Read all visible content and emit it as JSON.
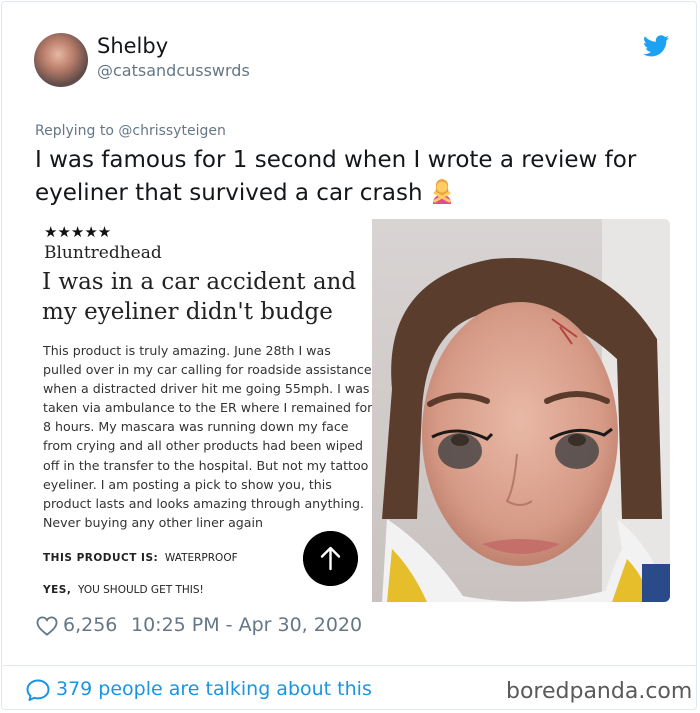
{
  "tweet": {
    "display_name": "Shelby",
    "handle": "@catsandcusswrds",
    "replying_to": "Replying to @chrissyteigen",
    "text": "I was famous for 1 second when I wrote a review for eyeliner that survived a car crash",
    "emoji": "person-gesturing-no-emoji",
    "likes": "6,256",
    "timestamp": "10:25 PM - Apr 30, 2020",
    "talking": "379 people are talking about this",
    "brand_color": "#1da1f2",
    "link_color": "#1b95e0"
  },
  "review": {
    "stars": "★★★★★",
    "reviewer": "Bluntredhead",
    "headline": "I was in a car accident and my eyeliner didn't budge",
    "body": "This product is truly amazing. June 28th I was pulled over in my car calling for roadside assistance when a distracted driver hit me going 55mph. I was taken via ambulance to the ER where I remained for 8 hours. My mascara was running down my face from crying and all other products had been wiped off in the transfer to the hospital. But not my tattoo eyeliner. I am posting a pick to show you, this product lasts and looks amazing through anything. Never buying any other liner again",
    "product_label": "THIS PRODUCT IS:",
    "product_value": "WATERPROOF",
    "yes_label": "YES,",
    "yes_value": "YOU SHOULD GET THIS!"
  },
  "watermark": "boredpanda.com"
}
